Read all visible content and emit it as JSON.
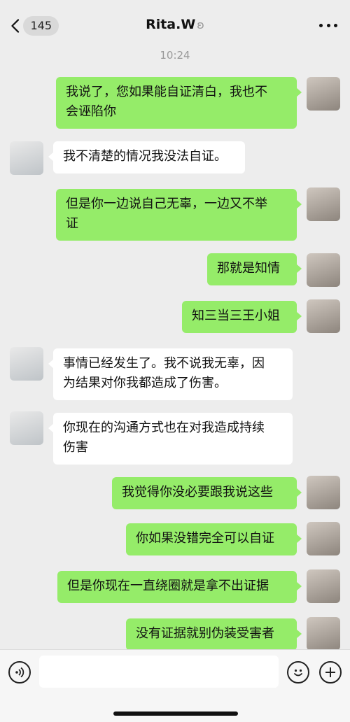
{
  "header": {
    "back_count": "145",
    "contact_name": "Rita.W",
    "ear_icon": "ear-icon"
  },
  "timestamp": "10:24",
  "messages": [
    {
      "side": "me",
      "text": "我说了，您如果能自证清白，我也不\n会诬陷你"
    },
    {
      "side": "them",
      "text": "我不清楚的情况我没法自证。"
    },
    {
      "side": "me",
      "text": "但是你一边说自己无辜，一边又不举\n证"
    },
    {
      "side": "me",
      "text": "那就是知情"
    },
    {
      "side": "me",
      "text": "知三当三王小姐"
    },
    {
      "side": "them",
      "text": "事情已经发生了。我不说我无辜，因\n为结果对你我都造成了伤害。"
    },
    {
      "side": "them",
      "text": "你现在的沟通方式也在对我造成持续\n伤害"
    },
    {
      "side": "me",
      "text": "我觉得你没必要跟我说这些"
    },
    {
      "side": "me",
      "text": "你如果没错完全可以自证"
    },
    {
      "side": "me",
      "text": "但是你现在一直绕圈就是拿不出证据"
    },
    {
      "side": "me",
      "text": "没有证据就别伪装受害者"
    }
  ],
  "colors": {
    "my_bubble": "#95ec69",
    "their_bubble": "#ffffff",
    "background": "#ededed"
  }
}
